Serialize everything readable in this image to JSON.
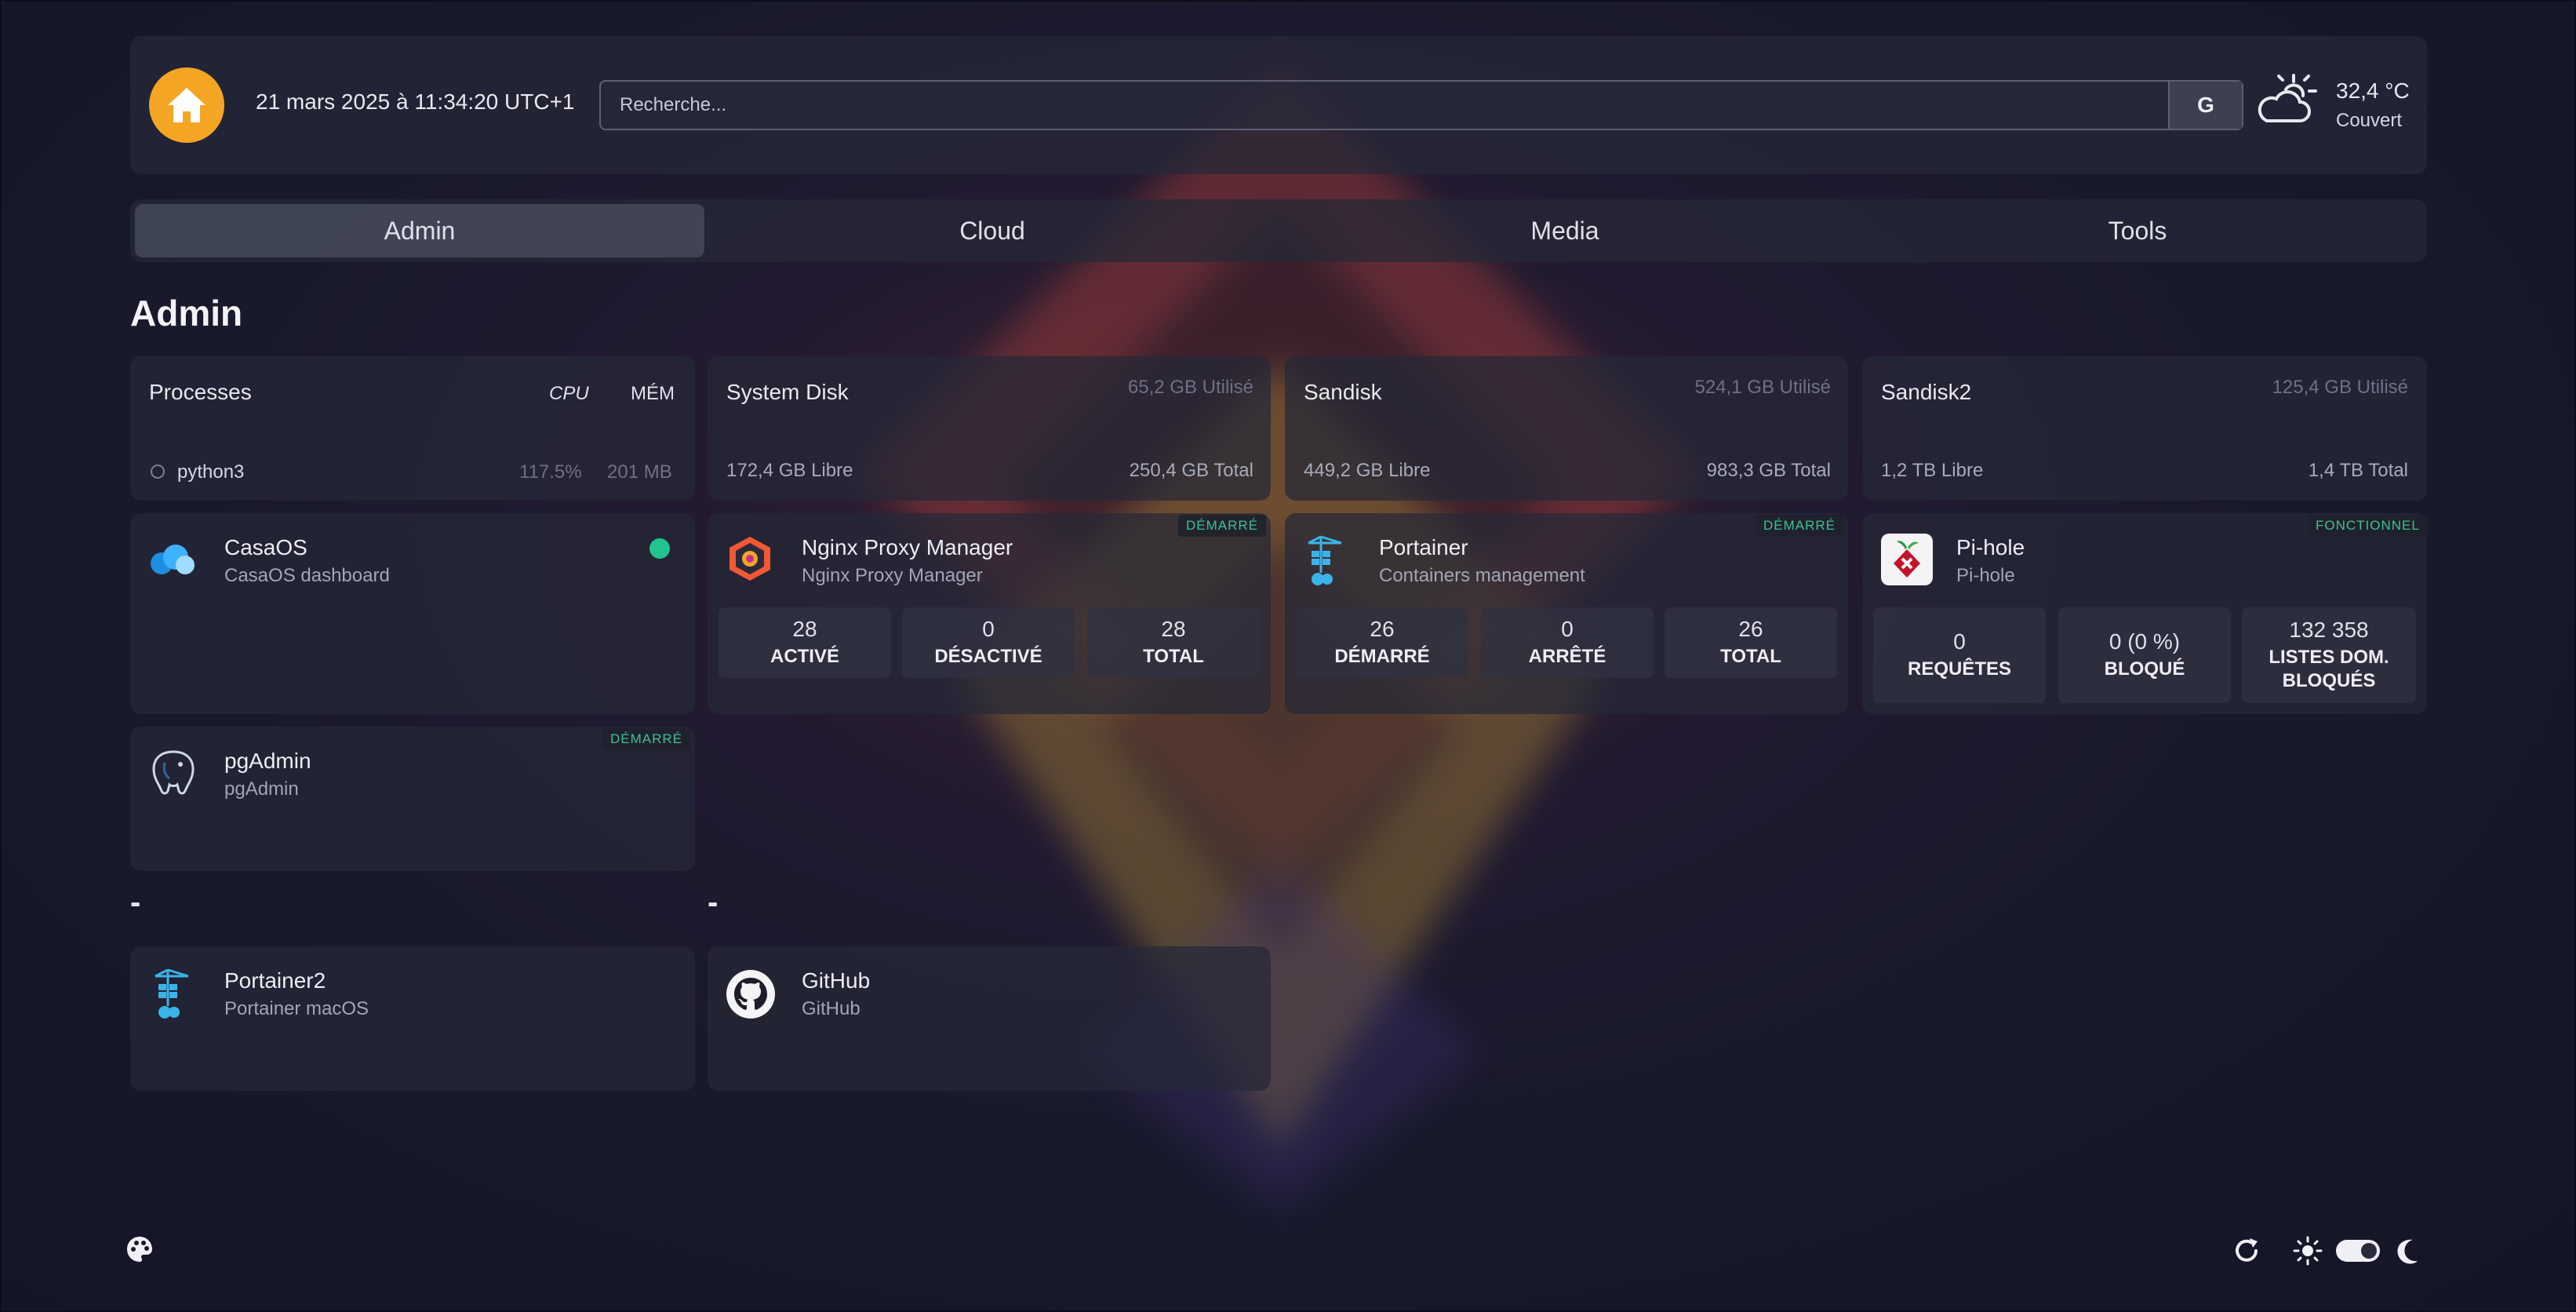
{
  "header": {
    "datetime": "21 mars 2025 à 11:34:20 UTC+1",
    "search_placeholder": "Recherche...",
    "search_provider": "G",
    "weather": {
      "temp": "32,4 °C",
      "condition": "Couvert",
      "icon": "partly-cloudy-day-icon"
    }
  },
  "tabs": [
    {
      "label": "Admin",
      "active": true
    },
    {
      "label": "Cloud",
      "active": false
    },
    {
      "label": "Media",
      "active": false
    },
    {
      "label": "Tools",
      "active": false
    }
  ],
  "section_title": "Admin",
  "widgets": {
    "processes": {
      "title": "Processes",
      "col_cpu": "CPU",
      "col_mem": "MÉM",
      "rows": [
        {
          "name": "python3",
          "cpu": "117.5%",
          "mem": "201 MB"
        }
      ]
    },
    "disks": [
      {
        "name": "System Disk",
        "used": "65,2 GB Utilisé",
        "free": "172,4 GB Libre",
        "total": "250,4 GB Total"
      },
      {
        "name": "Sandisk",
        "used": "524,1 GB Utilisé",
        "free": "449,2 GB Libre",
        "total": "983,3 GB Total"
      },
      {
        "name": "Sandisk2",
        "used": "125,4 GB Utilisé",
        "free": "1,2 TB Libre",
        "total": "1,4 TB Total"
      }
    ]
  },
  "services": {
    "casaos": {
      "name": "CasaOS",
      "desc": "CasaOS dashboard",
      "status_color": "#22c38e"
    },
    "nginx": {
      "name": "Nginx Proxy Manager",
      "desc": "Nginx Proxy Manager",
      "badge": "DÉMARRÉ",
      "stats": [
        {
          "value": "28",
          "label": "ACTIVÉ"
        },
        {
          "value": "0",
          "label": "DÉSACTIVÉ"
        },
        {
          "value": "28",
          "label": "TOTAL"
        }
      ]
    },
    "portainer": {
      "name": "Portainer",
      "desc": "Containers management",
      "badge": "DÉMARRÉ",
      "stats": [
        {
          "value": "26",
          "label": "DÉMARRÉ"
        },
        {
          "value": "0",
          "label": "ARRÊTÉ"
        },
        {
          "value": "26",
          "label": "TOTAL"
        }
      ]
    },
    "pihole": {
      "name": "Pi-hole",
      "desc": "Pi-hole",
      "badge": "FONCTIONNEL",
      "stats": [
        {
          "value": "0",
          "label": "REQUÊTES"
        },
        {
          "value": "0 (0 %)",
          "label": "BLOQUÉ"
        },
        {
          "value": "132 358",
          "label1": "LISTES DOM.",
          "label2": "BLOQUÉS"
        }
      ]
    },
    "pgadmin": {
      "name": "pgAdmin",
      "desc": "pgAdmin",
      "badge": "DÉMARRÉ"
    }
  },
  "groups": [
    {
      "title": "-",
      "services": [
        {
          "name": "Portainer2",
          "desc": "Portainer macOS"
        }
      ]
    },
    {
      "title": "-",
      "services": [
        {
          "name": "GitHub",
          "desc": "GitHub"
        }
      ]
    }
  ],
  "colors": {
    "accent_home": "#f5a524",
    "status_green": "#3fbf9a"
  }
}
